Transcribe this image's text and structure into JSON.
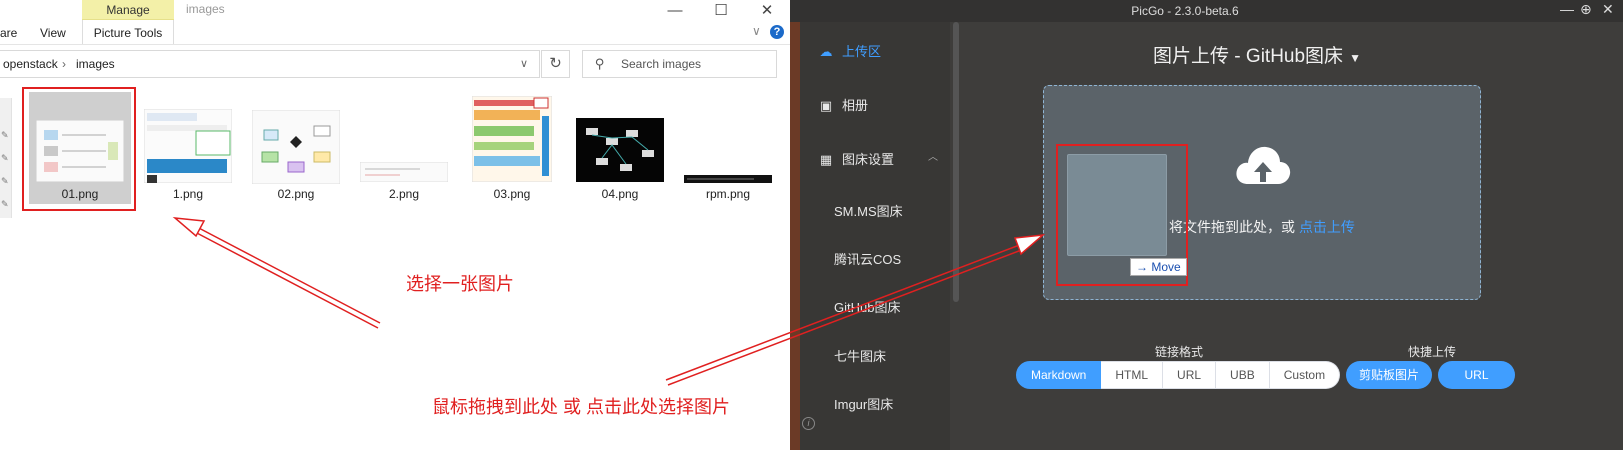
{
  "explorer": {
    "ribbon": {
      "manage_label": "Manage",
      "title": "images",
      "share_label": "are",
      "view_label": "View",
      "picture_tools_label": "Picture Tools",
      "minimize": "—",
      "maximize": "☐",
      "close": "✕",
      "chevron": "∨",
      "help": "?"
    },
    "address": {
      "crumbs": [
        "openstack",
        "images"
      ],
      "separator": "›",
      "dropdown": "∨",
      "refresh": "↻"
    },
    "search": {
      "placeholder": "Search images"
    },
    "files": [
      {
        "name": "01.png",
        "selected": true
      },
      {
        "name": "1.png"
      },
      {
        "name": "02.png"
      },
      {
        "name": "2.png"
      },
      {
        "name": "03.png"
      },
      {
        "name": "04.png"
      },
      {
        "name": "rpm.png"
      }
    ]
  },
  "annotations": {
    "select_one": "选择一张图片",
    "drag_or_click": "鼠标拖拽到此处 或 点击此处选择图片",
    "color": "#e02020"
  },
  "picgo": {
    "window_title": "PicGo - 2.3.0-beta.6",
    "controls": {
      "minimize": "—",
      "maximize": "⊕",
      "close": "✕"
    },
    "nav": {
      "upload": "上传区",
      "album": "相册",
      "settings": "图床设置",
      "collapse": "︿",
      "subs": [
        "SM.MS图床",
        "腾讯云COS",
        "GitHub图床",
        "七牛图床",
        "Imgur图床"
      ],
      "info": "i"
    },
    "heading": "图片上传 - GitHub图床",
    "heading_arrow": "▼",
    "dropzone": {
      "text": "将文件拖到此处，或 ",
      "link": "点击上传",
      "move_tip": "Move",
      "move_arrow": "→"
    },
    "link_format_label": "链接格式",
    "quick_upload_label": "快捷上传",
    "formats": [
      "Markdown",
      "HTML",
      "URL",
      "UBB",
      "Custom"
    ],
    "active_format": "Markdown",
    "quick": [
      "剪贴板图片",
      "URL"
    ],
    "accent": "#409eff"
  }
}
